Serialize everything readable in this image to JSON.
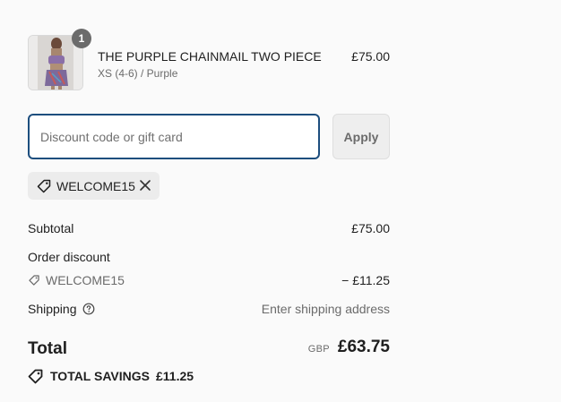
{
  "product": {
    "quantity": "1",
    "title": "THE PURPLE CHAINMAIL TWO PIECE",
    "variant": "XS (4-6) / Purple",
    "price": "£75.00"
  },
  "discount": {
    "placeholder": "Discount code or gift card",
    "value": "",
    "apply_label": "Apply",
    "applied_code": "WELCOME15"
  },
  "summary": {
    "subtotal_label": "Subtotal",
    "subtotal_value": "£75.00",
    "order_discount_label": "Order discount",
    "discount_code": "WELCOME15",
    "discount_value": "− £11.25",
    "shipping_label": "Shipping",
    "shipping_value": "Enter shipping address",
    "total_label": "Total",
    "currency": "GBP",
    "total_value": "£63.75",
    "savings_label": "TOTAL SAVINGS",
    "savings_value": "£11.25"
  },
  "icons": {
    "tag": "tag-icon",
    "remove": "close-icon",
    "help": "question-circle-icon",
    "savings": "savings-tag-icon"
  },
  "colors": {
    "input_border": "#1d4e7e",
    "badge": "#6b6b6b",
    "chip_bg": "#ececec"
  }
}
